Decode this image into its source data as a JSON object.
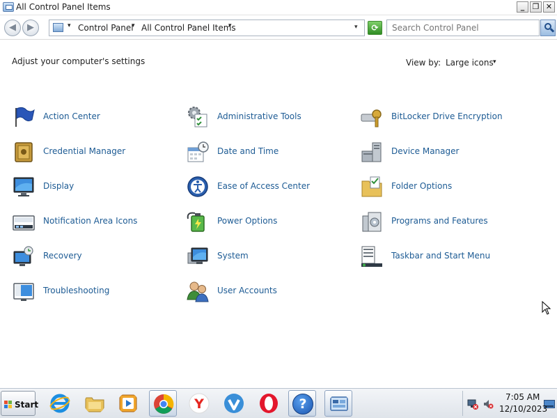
{
  "window": {
    "title": "All Control Panel Items",
    "controls": {
      "minimize": "_",
      "maximize": "❐",
      "close": "✕"
    }
  },
  "navbar": {
    "back": "◀",
    "forward": "▶",
    "crumb_separator": "▾",
    "breadcrumbs": [
      "Control Panel",
      "All Control Panel Items"
    ],
    "dropdown": "▾",
    "refresh": "⟳",
    "search_placeholder": "Search Control Panel"
  },
  "content": {
    "heading": "Adjust your computer's settings",
    "view_by_label": "View by:",
    "view_by_value": "Large icons",
    "view_by_caret": "▾",
    "items": [
      {
        "label": "Action Center",
        "icon": "action-center-flag-icon"
      },
      {
        "label": "Administrative Tools",
        "icon": "administrative-tools-icon"
      },
      {
        "label": "BitLocker Drive Encryption",
        "icon": "bitlocker-key-icon"
      },
      {
        "label": "Credential Manager",
        "icon": "credential-vault-icon"
      },
      {
        "label": "Date and Time",
        "icon": "date-time-icon"
      },
      {
        "label": "Device Manager",
        "icon": "device-manager-icon"
      },
      {
        "label": "Display",
        "icon": "display-monitor-icon"
      },
      {
        "label": "Ease of Access Center",
        "icon": "ease-of-access-icon"
      },
      {
        "label": "Folder Options",
        "icon": "folder-options-icon"
      },
      {
        "label": "Notification Area Icons",
        "icon": "notification-area-icon"
      },
      {
        "label": "Power Options",
        "icon": "power-options-icon"
      },
      {
        "label": "Programs and Features",
        "icon": "programs-features-icon"
      },
      {
        "label": "Recovery",
        "icon": "recovery-icon"
      },
      {
        "label": "System",
        "icon": "system-icon"
      },
      {
        "label": "Taskbar and Start Menu",
        "icon": "taskbar-start-menu-icon"
      },
      {
        "label": "Troubleshooting",
        "icon": "troubleshooting-icon"
      },
      {
        "label": "User Accounts",
        "icon": "user-accounts-icon"
      }
    ]
  },
  "taskbar": {
    "start_label": "Start",
    "apps": [
      {
        "icon": "internet-explorer-icon"
      },
      {
        "icon": "file-explorer-icon"
      },
      {
        "icon": "media-player-icon"
      },
      {
        "icon": "chrome-icon"
      },
      {
        "icon": "yandex-browser-icon"
      },
      {
        "icon": "vivaldi-icon"
      },
      {
        "icon": "opera-icon"
      },
      {
        "icon": "help-icon",
        "label": "?"
      },
      {
        "icon": "control-panel-icon"
      }
    ],
    "yandex_letter": "Y",
    "clock_time": "7:05 AM",
    "clock_date": "12/10/2023"
  },
  "colors": {
    "link": "#1d5b94",
    "accent_blue": "#2a6dc0"
  }
}
